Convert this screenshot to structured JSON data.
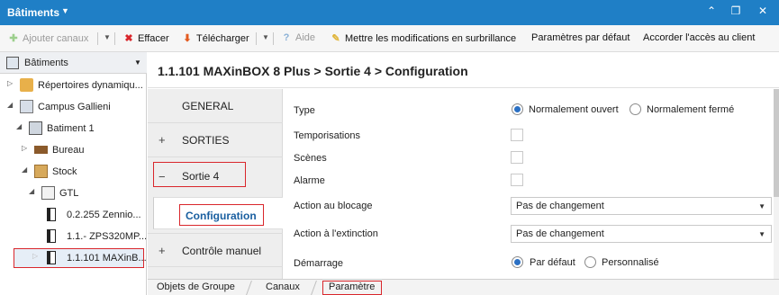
{
  "window": {
    "title": "Bâtiments",
    "caret_icon": "caret-down-icon",
    "controls": [
      "chevron-up-icon",
      "restore-icon",
      "close-icon"
    ]
  },
  "toolbar": {
    "add_channels": "Ajouter canaux",
    "delete": "Effacer",
    "download": "Télécharger",
    "help": "Aide",
    "apply_changes": "Mettre les modifications en surbrillance",
    "default_params": "Paramètres par défaut",
    "grant_access": "Accorder l'accès au client"
  },
  "left_panel": {
    "header": "Bâtiments",
    "nodes": [
      {
        "label": "Répertoires dynamiqu...",
        "icon": "folder-icon",
        "toggle": "▷"
      },
      {
        "label": "Campus Gallieni",
        "icon": "campus-icon",
        "toggle": "◢"
      },
      {
        "label": "Batiment 1",
        "icon": "building-icon",
        "toggle": "◢"
      },
      {
        "label": "Bureau",
        "icon": "desk-icon",
        "toggle": "▷"
      },
      {
        "label": "Stock",
        "icon": "boxes-icon",
        "toggle": "◢"
      },
      {
        "label": "GTL",
        "icon": "cabinet-icon",
        "toggle": "◢"
      },
      {
        "label": "0.2.255 Zennio...",
        "icon": "device-icon",
        "toggle": ""
      },
      {
        "label": "1.1.- ZPS320MP...",
        "icon": "device-icon",
        "toggle": ""
      },
      {
        "label": "1.1.101 MAXinB...",
        "icon": "device-icon",
        "toggle": "▷"
      }
    ]
  },
  "breadcrumb": "1.1.101 MAXinBOX 8 Plus > Sortie 4 > Configuration",
  "sidenav": {
    "general": "GENERAL",
    "sorties": "SORTIES",
    "sortie4": "Sortie 4",
    "configuration": "Configuration",
    "manual": "Contrôle manuel",
    "plus": "+",
    "minus": "−"
  },
  "params": {
    "type_label": "Type",
    "type_opt1": "Normalement ouvert",
    "type_opt2": "Normalement fermé",
    "type_selected": "Normalement ouvert",
    "temporisations": "Temporisations",
    "scenes": "Scènes",
    "alarme": "Alarme",
    "blocage_label": "Action au blocage",
    "blocage_value": "Pas de changement",
    "extinction_label": "Action à l'extinction",
    "extinction_value": "Pas de changement",
    "demarrage_label": "Démarrage",
    "demarrage_opt1": "Par défaut",
    "demarrage_opt2": "Personnalisé",
    "demarrage_selected": "Par défaut"
  },
  "bottom_tabs": {
    "groups": "Objets de Groupe",
    "channels": "Canaux",
    "params": "Paramètre",
    "active": "Paramètre"
  },
  "colors": {
    "accent": "#1f7fc6",
    "highlight_border": "#d9262b",
    "link": "#1a5fa0"
  }
}
